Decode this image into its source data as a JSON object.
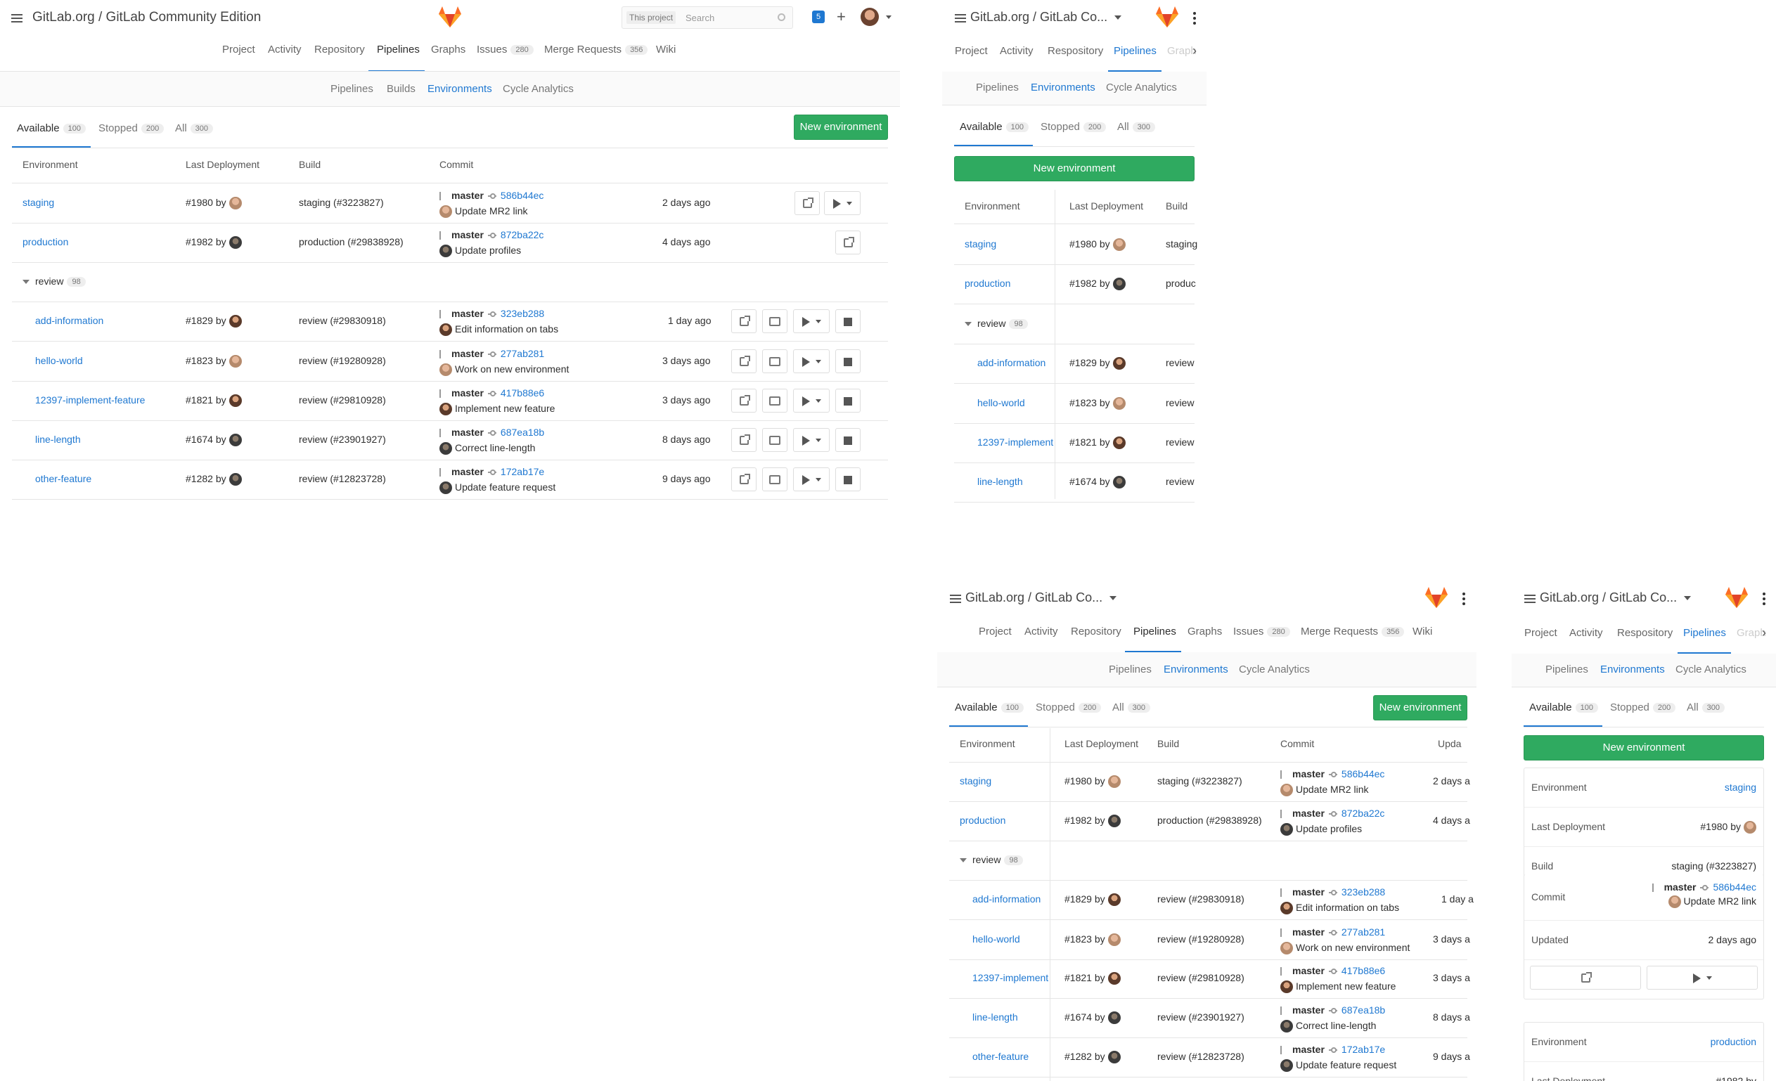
{
  "project": {
    "full_title": "GitLab.org / GitLab Community Edition",
    "short_title": "GitLab.org / GitLab Co..."
  },
  "search": {
    "scope": "This project",
    "placeholder": "Search"
  },
  "notifications_count": "5",
  "nav": {
    "project": "Project",
    "activity": "Activity",
    "repository": "Repository",
    "respository_mobile": "Respository",
    "pipelines": "Pipelines",
    "graphs": "Graphs",
    "graphs_cut": "Graph",
    "issues": "Issues",
    "issues_count": "280",
    "merge_requests": "Merge Requests",
    "merge_requests_count": "356",
    "wiki": "Wiki"
  },
  "subnav": {
    "pipelines": "Pipelines",
    "builds": "Builds",
    "environments": "Environments",
    "cycle_analytics": "Cycle Analytics"
  },
  "tabs": {
    "available": "Available",
    "available_count": "100",
    "stopped": "Stopped",
    "stopped_count": "200",
    "all": "All",
    "all_count": "300"
  },
  "new_environment": "New environment",
  "columns": {
    "environment": "Environment",
    "last_deployment": "Last Deployment",
    "build": "Build",
    "commit": "Commit",
    "updated_cut": "Upda",
    "updated": "Updated"
  },
  "review_folder": {
    "name": "review",
    "count": "98"
  },
  "environments": [
    {
      "name": "staging",
      "name_short": "staging",
      "deployment": "#1980 by",
      "avatar": "light",
      "build": "staging (#3223827)",
      "build_cut": "staging",
      "branch": "master",
      "sha": "586b44ec",
      "message": "Update MR2 link",
      "updated": "2 days ago",
      "updated_cut": "2 days a"
    },
    {
      "name": "production",
      "name_short": "production",
      "deployment": "#1982 by",
      "avatar": "dark",
      "build": "production (#29838928)",
      "build_cut": "produc",
      "branch": "master",
      "sha": "872ba22c",
      "message": "Update profiles",
      "updated": "4 days ago",
      "updated_cut": "4 days a"
    },
    {
      "name": "add-information",
      "name_short": "add-information",
      "deployment": "#1829 by",
      "avatar": "mid",
      "build": "review (#29830918)",
      "build_cut": "review",
      "branch": "master",
      "sha": "323eb288",
      "message": "Edit information on tabs",
      "updated": "1 day ago",
      "updated_cut": "1 day a"
    },
    {
      "name": "hello-world",
      "name_short": "hello-world",
      "deployment": "#1823 by",
      "avatar": "light",
      "build": "review (#19280928)",
      "build_cut": "review",
      "branch": "master",
      "sha": "277ab281",
      "message": "Work on new environment",
      "updated": "3 days ago",
      "updated_cut": "3 days a"
    },
    {
      "name": "12397-implement-feature",
      "name_short": "12397-implement",
      "deployment": "#1821 by",
      "avatar": "mid",
      "build": "review (#29810928)",
      "build_cut": "review",
      "branch": "master",
      "sha": "417b88e6",
      "message": "Implement new feature",
      "updated": "3 days ago",
      "updated_cut": "3 days a"
    },
    {
      "name": "line-length",
      "name_short": "line-length",
      "deployment": "#1674 by",
      "avatar": "dark",
      "build": "review (#23901927)",
      "build_cut": "review",
      "branch": "master",
      "sha": "687ea18b",
      "message": "Correct line-length",
      "updated": "8 days ago",
      "updated_cut": "8 days a"
    },
    {
      "name": "other-feature",
      "name_short": "other-feature",
      "deployment": "#1282 by",
      "avatar": "dark",
      "build": "review (#12823728)",
      "build_cut": "review",
      "branch": "master",
      "sha": "172ab17e",
      "message": "Update feature request",
      "updated": "9 days ago",
      "updated_cut": "9 days a"
    }
  ],
  "mobile_card": {
    "environment_label": "Environment",
    "last_deployment_label": "Last Deployment",
    "build_label": "Build",
    "commit_label": "Commit",
    "updated_label": "Updated",
    "environment": "staging",
    "deployment": "#1980 by",
    "build": "staging (#3223827)",
    "branch": "master",
    "sha": "586b44ec",
    "message": "Update MR2 link",
    "updated": "2 days ago",
    "next_environment": "production",
    "next_deployment": "#1982 by"
  },
  "colors": {
    "accent": "#1f78d1",
    "green": "#2faa60",
    "logo": "#e24329"
  }
}
